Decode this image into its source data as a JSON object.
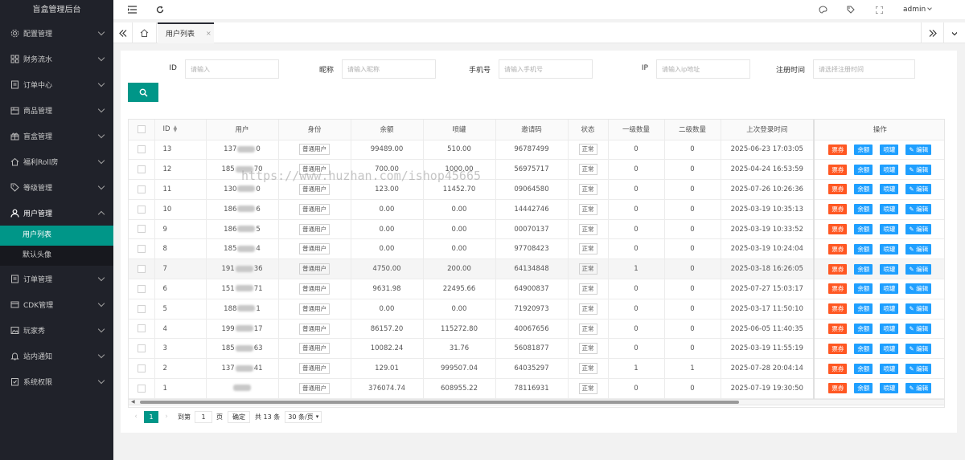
{
  "app": {
    "title": "盲盒管理后台"
  },
  "sidebar": {
    "items": [
      {
        "label": "配置管理",
        "icon": "settings-icon",
        "open": false
      },
      {
        "label": "财务流水",
        "icon": "grid-icon",
        "open": false
      },
      {
        "label": "订单中心",
        "icon": "document-icon",
        "open": false
      },
      {
        "label": "商品管理",
        "icon": "box-icon",
        "open": false
      },
      {
        "label": "盲盒管理",
        "icon": "gift-icon",
        "open": false
      },
      {
        "label": "福利Roll房",
        "icon": "home-icon",
        "open": false
      },
      {
        "label": "等级管理",
        "icon": "tag-icon",
        "open": false
      },
      {
        "label": "用户管理",
        "icon": "user-icon",
        "open": true
      },
      {
        "label": "订单管理",
        "icon": "document-icon",
        "open": false
      },
      {
        "label": "CDK管理",
        "icon": "card-icon",
        "open": false
      },
      {
        "label": "玩家秀",
        "icon": "image-icon",
        "open": false
      },
      {
        "label": "站内通知",
        "icon": "bell-icon",
        "open": false
      },
      {
        "label": "系统权限",
        "icon": "shield-icon",
        "open": false
      }
    ],
    "sub_items": [
      {
        "label": "用户列表",
        "active": true
      },
      {
        "label": "默认头像",
        "active": false
      }
    ]
  },
  "header": {
    "user": "admin"
  },
  "tabs": {
    "active_label": "用户列表",
    "close": "×"
  },
  "filters": {
    "id": {
      "label": "ID",
      "placeholder": "请输入"
    },
    "nickname": {
      "label": "昵称",
      "placeholder": "请输入昵称"
    },
    "phone": {
      "label": "手机号",
      "placeholder": "请输入手机号"
    },
    "ip": {
      "label": "IP",
      "placeholder": "请输入ip地址"
    },
    "regtime": {
      "label": "注册时间",
      "placeholder": "请选择注册时间"
    }
  },
  "table": {
    "columns": [
      "ID",
      "用户",
      "身份",
      "余额",
      "喷罐",
      "邀请码",
      "状态",
      "一级数量",
      "二级数量",
      "上次登录时间",
      "操作"
    ],
    "rows": [
      {
        "id": "13",
        "user_pre": "137",
        "user_suf": "0",
        "role": "普通用户",
        "balance": "99489.00",
        "spray": "510.00",
        "code": "96787499",
        "status": "正常",
        "l1": "0",
        "l2": "0",
        "last": "2025-06-23 17:03:05"
      },
      {
        "id": "12",
        "user_pre": "185",
        "user_suf": "70",
        "role": "普通用户",
        "balance": "700.00",
        "spray": "1000.00",
        "code": "56975717",
        "status": "正常",
        "l1": "0",
        "l2": "0",
        "last": "2025-04-24 16:53:59"
      },
      {
        "id": "11",
        "user_pre": "130",
        "user_suf": "0",
        "role": "普通用户",
        "balance": "123.00",
        "spray": "11452.70",
        "code": "09064580",
        "status": "正常",
        "l1": "0",
        "l2": "0",
        "last": "2025-07-26 10:26:36"
      },
      {
        "id": "10",
        "user_pre": "186",
        "user_suf": "6",
        "role": "普通用户",
        "balance": "0.00",
        "spray": "0.00",
        "code": "14442746",
        "status": "正常",
        "l1": "0",
        "l2": "0",
        "last": "2025-03-19 10:35:13"
      },
      {
        "id": "9",
        "user_pre": "186",
        "user_suf": "5",
        "role": "普通用户",
        "balance": "0.00",
        "spray": "0.00",
        "code": "00070137",
        "status": "正常",
        "l1": "0",
        "l2": "0",
        "last": "2025-03-19 10:33:52"
      },
      {
        "id": "8",
        "user_pre": "185",
        "user_suf": "4",
        "role": "普通用户",
        "balance": "0.00",
        "spray": "0.00",
        "code": "97708423",
        "status": "正常",
        "l1": "0",
        "l2": "0",
        "last": "2025-03-19 10:24:04"
      },
      {
        "id": "7",
        "user_pre": "191",
        "user_suf": "36",
        "role": "普通用户",
        "balance": "4750.00",
        "spray": "200.00",
        "code": "64134848",
        "status": "正常",
        "l1": "1",
        "l2": "0",
        "last": "2025-03-18 16:26:05"
      },
      {
        "id": "6",
        "user_pre": "151",
        "user_suf": "71",
        "role": "普通用户",
        "balance": "9631.98",
        "spray": "22495.66",
        "code": "64900837",
        "status": "正常",
        "l1": "0",
        "l2": "0",
        "last": "2025-07-27 15:03:17"
      },
      {
        "id": "5",
        "user_pre": "188",
        "user_suf": "1",
        "role": "普通用户",
        "balance": "0.00",
        "spray": "0.00",
        "code": "71920973",
        "status": "正常",
        "l1": "0",
        "l2": "0",
        "last": "2025-03-17 11:50:10"
      },
      {
        "id": "4",
        "user_pre": "199",
        "user_suf": "17",
        "role": "普通用户",
        "balance": "86157.20",
        "spray": "115272.80",
        "code": "40067656",
        "status": "正常",
        "l1": "0",
        "l2": "0",
        "last": "2025-06-05 11:40:35"
      },
      {
        "id": "3",
        "user_pre": "185",
        "user_suf": "63",
        "role": "普通用户",
        "balance": "10082.24",
        "spray": "31.76",
        "code": "56081877",
        "status": "正常",
        "l1": "0",
        "l2": "0",
        "last": "2025-03-19 11:55:19"
      },
      {
        "id": "2",
        "user_pre": "137",
        "user_suf": "41",
        "role": "普通用户",
        "balance": "129.01",
        "spray": "999507.04",
        "code": "64035297",
        "status": "正常",
        "l1": "1",
        "l2": "1",
        "last": "2025-07-28 20:04:14"
      },
      {
        "id": "1",
        "user_pre": "",
        "user_suf": "",
        "role": "普通用户",
        "balance": "376074.74",
        "spray": "608955.22",
        "code": "78116931",
        "status": "正常",
        "l1": "0",
        "l2": "0",
        "last": "2025-07-19 19:30:50"
      }
    ],
    "actions": {
      "ticket": "票券",
      "balance": "余额",
      "spray": "喷罐",
      "edit": "编辑"
    }
  },
  "pager": {
    "current": "1",
    "goto_label": "到第",
    "goto_value": "1",
    "page_unit": "页",
    "confirm": "确定",
    "total": "共 13 条",
    "per_page": "30 条/页"
  },
  "watermark": "https://www.huzhan.com/ishop45665",
  "colors": {
    "primary": "#009688",
    "sidebar": "#20222a",
    "red": "#ff5722",
    "blue": "#1e9fff"
  }
}
